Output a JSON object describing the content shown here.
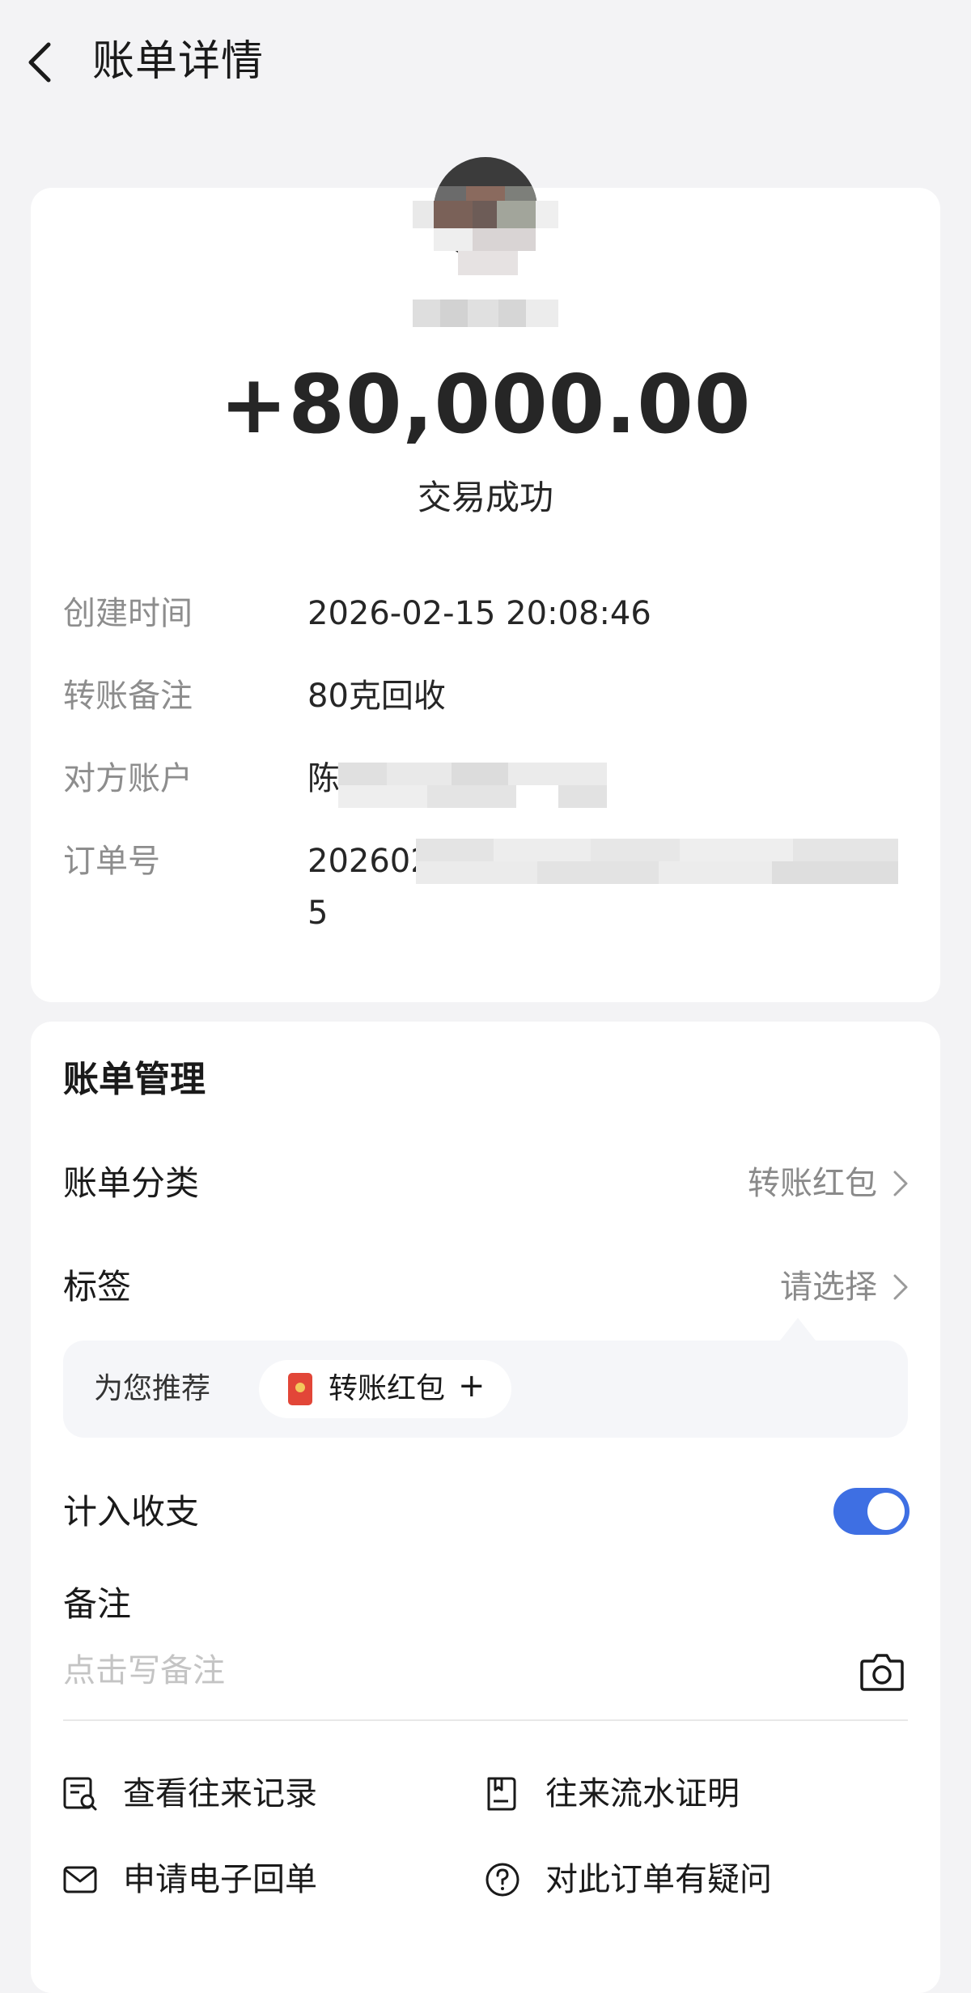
{
  "header": {
    "title": "账单详情"
  },
  "summary": {
    "amount": "+80,000.00",
    "status": "交易成功"
  },
  "details": [
    {
      "label": "创建时间",
      "value": "2026-02-15 20:08:46"
    },
    {
      "label": "转账备注",
      "value": "80克回收"
    },
    {
      "label": "对方账户",
      "value": "陈"
    },
    {
      "label": "订单号",
      "value": "202602",
      "value_line2": "5"
    }
  ],
  "management": {
    "title": "账单管理",
    "category": {
      "label": "账单分类",
      "value": "转账红包"
    },
    "tags": {
      "label": "标签",
      "value": "请选择"
    },
    "recommend": {
      "label": "为您推荐",
      "chip_label": "转账红包",
      "chip_plus": "+"
    },
    "include_in_budget": {
      "label": "计入收支",
      "enabled": true
    },
    "remark": {
      "label": "备注",
      "placeholder": "点击写备注"
    }
  },
  "actions": [
    {
      "label": "查看往来记录",
      "icon": "record-list-icon"
    },
    {
      "label": "往来流水证明",
      "icon": "statement-proof-icon"
    },
    {
      "label": "申请电子回单",
      "icon": "envelope-icon"
    },
    {
      "label": "对此订单有疑问",
      "icon": "question-circle-icon"
    }
  ],
  "colors": {
    "background": "#f3f3f5",
    "card": "#ffffff",
    "toggle_on": "#3e6fe3",
    "muted_text": "#8d8d8d",
    "red_packet": "#e24638"
  }
}
